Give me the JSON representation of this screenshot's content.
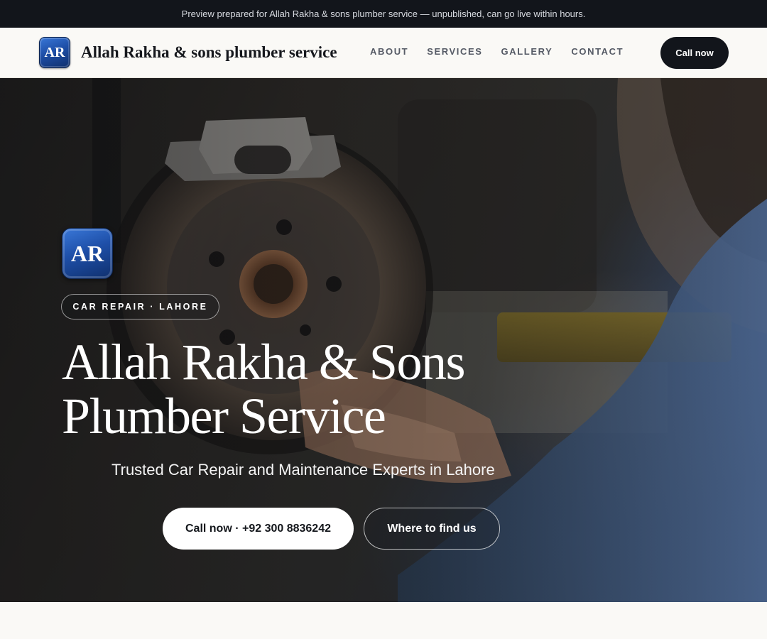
{
  "preview_banner": {
    "text": "Preview prepared for Allah Rakha & sons plumber service — unpublished, can go live within hours."
  },
  "header": {
    "logo_initials": "AR",
    "brand_name": "Allah Rakha & sons plumber service",
    "nav": [
      {
        "label": "ABOUT"
      },
      {
        "label": "SERVICES"
      },
      {
        "label": "GALLERY"
      },
      {
        "label": "CONTACT"
      }
    ],
    "call_button": "Call now"
  },
  "hero": {
    "logo_initials": "AR",
    "tag": "CAR REPAIR · LAHORE",
    "title_line1": "Allah Rakha & Sons",
    "title_line2": "Plumber Service",
    "subtitle": "Trusted Car Repair and Maintenance Experts in Lahore",
    "primary_cta": "Call now · +92 300 8836242",
    "secondary_cta": "Where to find us",
    "background_image": "mechanic-brake-disc-photo"
  },
  "colors": {
    "dark": "#12151b",
    "page_bg": "#faf9f6",
    "logo_blue": "#1e4fa8",
    "nav_text": "#565b66"
  }
}
